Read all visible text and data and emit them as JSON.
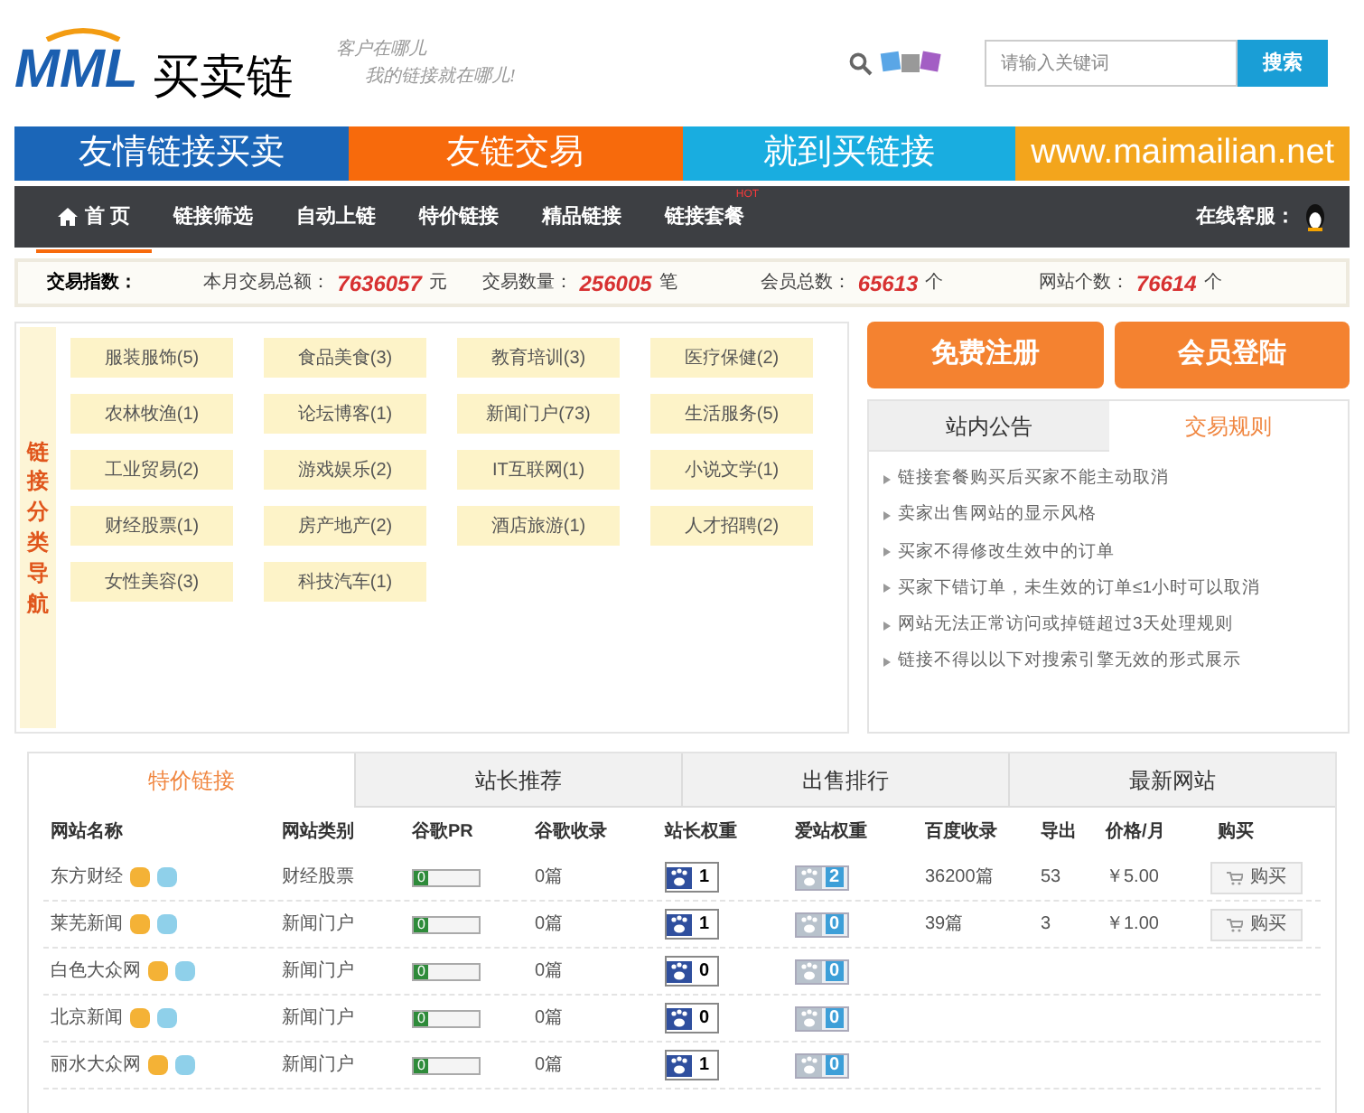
{
  "logo": {
    "mark": "MML",
    "name": "买卖链"
  },
  "slogan": [
    "客户在哪儿",
    "我的链接就在哪儿!"
  ],
  "search": {
    "placeholder": "请输入关键词",
    "button": "搜索"
  },
  "banner": [
    {
      "text": "友情链接买卖",
      "color": "#1b66b8"
    },
    {
      "text": "友链交易",
      "color": "#f76a0c"
    },
    {
      "text": "就到买链接",
      "color": "#19ade0"
    },
    {
      "text": "www.maimailian.net",
      "color": "#f3a51c"
    }
  ],
  "nav": {
    "items": [
      {
        "label": "首 页",
        "selected": true
      },
      {
        "label": "链接筛选",
        "selected": false
      },
      {
        "label": "自动上链",
        "selected": false
      },
      {
        "label": "特价链接",
        "selected": false
      },
      {
        "label": "精品链接",
        "selected": false
      },
      {
        "label": "链接套餐",
        "selected": false,
        "badge": "HOT"
      }
    ],
    "service": "在线客服："
  },
  "stats": {
    "label": "交易指数：",
    "items": [
      {
        "label": "本月交易总额：",
        "value": "7636057",
        "unit": "元"
      },
      {
        "label": "交易数量：",
        "value": "256005",
        "unit": "笔"
      },
      {
        "label": "会员总数：",
        "value": "65613",
        "unit": "个"
      },
      {
        "label": "网站个数：",
        "value": "76614",
        "unit": "个"
      }
    ]
  },
  "categories": {
    "title": "链接分类导航",
    "items": [
      "服装服饰(5)",
      "食品美食(3)",
      "教育培训(3)",
      "医疗保健(2)",
      "农林牧渔(1)",
      "论坛博客(1)",
      "新闻门户(73)",
      "生活服务(5)",
      "工业贸易(2)",
      "游戏娱乐(2)",
      "IT互联网(1)",
      "小说文学(1)",
      "财经股票(1)",
      "房产地产(2)",
      "酒店旅游(1)",
      "人才招聘(2)",
      "女性美容(3)",
      "科技汽车(1)"
    ]
  },
  "account_buttons": [
    "免费注册",
    "会员登陆"
  ],
  "notice": {
    "tabs": [
      {
        "label": "站内公告",
        "selected": false
      },
      {
        "label": "交易规则",
        "selected": true
      }
    ],
    "items": [
      "链接套餐购买后买家不能主动取消",
      "卖家出售网站的显示风格",
      "买家不得修改生效中的订单",
      "买家下错订单，未生效的订单≤1小时可以取消",
      "网站无法正常访问或掉链超过3天处理规则",
      "链接不得以以下对搜索引擎无效的形式展示"
    ]
  },
  "listing": {
    "tabs": [
      {
        "label": "特价链接",
        "selected": true
      },
      {
        "label": "站长推荐",
        "selected": false
      },
      {
        "label": "出售排行",
        "selected": false
      },
      {
        "label": "最新网站",
        "selected": false
      }
    ],
    "columns": [
      "网站名称",
      "网站类别",
      "谷歌PR",
      "谷歌收录",
      "站长权重",
      "爱站权重",
      "百度收录",
      "导出",
      "价格/月",
      "购买"
    ],
    "rows": [
      {
        "name": "东方财经",
        "category": "财经股票",
        "pr": "0",
        "google": "0篇",
        "baidu_weight": "1",
        "aizhan_weight": "2",
        "baidu_index": "36200篇",
        "outbound": "53",
        "price": "￥5.00",
        "buy": "购买"
      },
      {
        "name": "莱芜新闻",
        "category": "新闻门户",
        "pr": "0",
        "google": "0篇",
        "baidu_weight": "1",
        "aizhan_weight": "0",
        "baidu_index": "39篇",
        "outbound": "3",
        "price": "￥1.00",
        "buy": "购买"
      },
      {
        "name": "白色大众网",
        "category": "新闻门户",
        "pr": "0",
        "google": "0篇",
        "baidu_weight": "0",
        "aizhan_weight": "0"
      },
      {
        "name": "北京新闻",
        "category": "新闻门户",
        "pr": "0",
        "google": "0篇",
        "baidu_weight": "0",
        "aizhan_weight": "0"
      },
      {
        "name": "丽水大众网",
        "category": "新闻门户",
        "pr": "0",
        "google": "0篇",
        "baidu_weight": "1",
        "aizhan_weight": "0"
      }
    ]
  }
}
